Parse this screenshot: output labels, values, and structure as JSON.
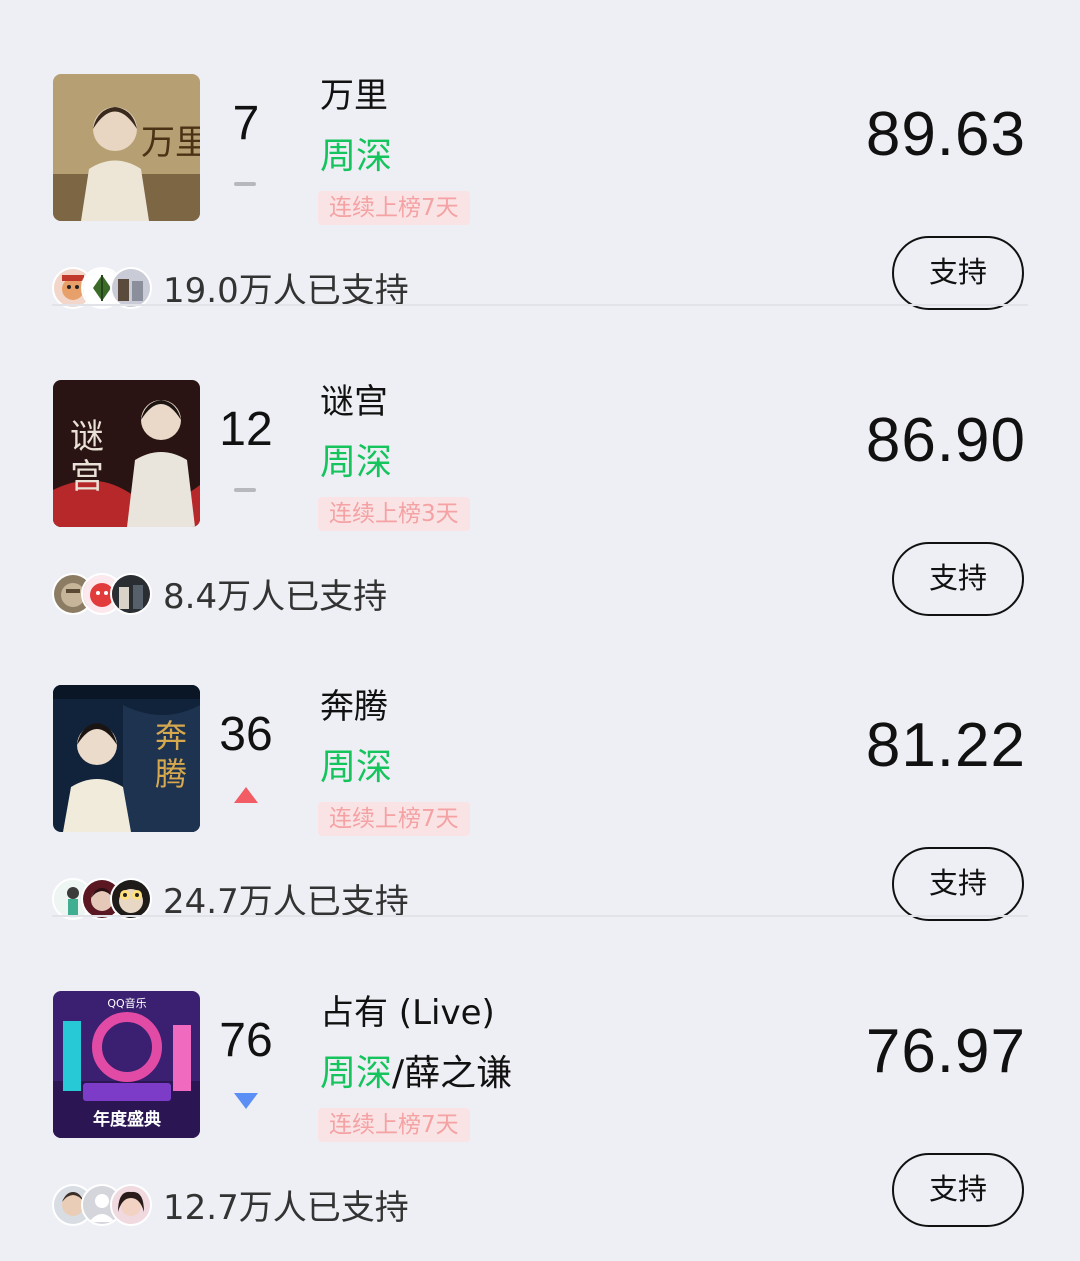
{
  "entries": [
    {
      "rank": "7",
      "trend": "flat",
      "title": "万里",
      "artist": "周深",
      "artist_other": "",
      "streak": "连续上榜7天",
      "score": "89.63",
      "support_label": "支持",
      "supporters": "19.0万人已支持",
      "cover_text": "万里",
      "cover_palette": [
        "#a08c63",
        "#e5dcc6",
        "#3b2a14"
      ]
    },
    {
      "rank": "12",
      "trend": "flat",
      "title": "谜宫",
      "artist": "周深",
      "artist_other": "",
      "streak": "连续上榜3天",
      "score": "86.90",
      "support_label": "支持",
      "supporters": "8.4万人已支持",
      "cover_text": "谜宫",
      "cover_palette": [
        "#3a1614",
        "#b6282a",
        "#e9e1d6"
      ]
    },
    {
      "rank": "36",
      "trend": "up",
      "title": "奔腾",
      "artist": "周深",
      "artist_other": "",
      "streak": "连续上榜7天",
      "score": "81.22",
      "support_label": "支持",
      "supporters": "24.7万人已支持",
      "cover_text": "奔腾",
      "cover_palette": [
        "#10223a",
        "#c9a04a",
        "#f1ebdb"
      ]
    },
    {
      "rank": "76",
      "trend": "down",
      "title": "占有 (Live)",
      "artist": "周深",
      "artist_other": "/薛之谦",
      "streak": "连续上榜7天",
      "score": "76.97",
      "support_label": "支持",
      "supporters": "12.7万人已支持",
      "cover_text": "年度盛典",
      "cover_palette": [
        "#3b1f70",
        "#e24ba5",
        "#27c9d6"
      ]
    }
  ],
  "colors": {
    "background": "#eeeff4",
    "artist_green": "#16c45e",
    "streak_bg": "#fae3e4",
    "streak_text": "#f4a2a4",
    "trend_up": "#f25c64",
    "trend_down": "#5b8ff5",
    "trend_flat": "#b7b8bd"
  }
}
